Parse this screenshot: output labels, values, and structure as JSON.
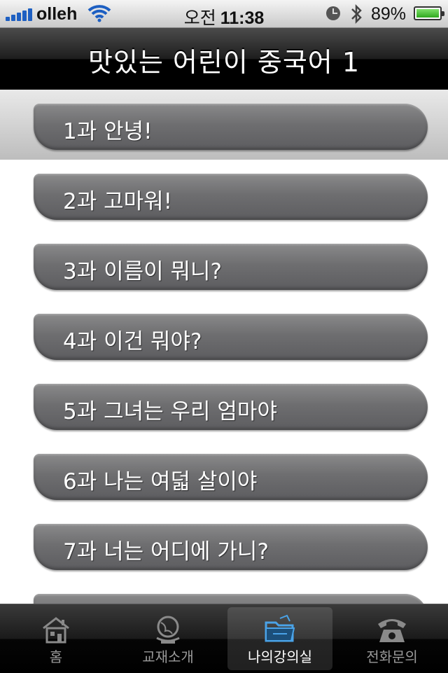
{
  "status_bar": {
    "carrier": "olleh",
    "time_period": "오전",
    "time": "11:38",
    "battery_percent": "89%"
  },
  "nav": {
    "title": "맛있는 어린이 중국어 1"
  },
  "lessons": [
    {
      "label": "1과 안녕!",
      "selected": true
    },
    {
      "label": "2과 고마워!",
      "selected": false
    },
    {
      "label": "3과 이름이 뭐니?",
      "selected": false
    },
    {
      "label": "4과 이건 뭐야?",
      "selected": false
    },
    {
      "label": "5과 그녀는 우리 엄마야",
      "selected": false
    },
    {
      "label": "6과 나는 여덟 살이야",
      "selected": false
    },
    {
      "label": "7과 너는 어디에 가니?",
      "selected": false
    },
    {
      "label": "",
      "selected": false
    }
  ],
  "tabs": [
    {
      "label": "홈",
      "icon": "house-icon",
      "active": false
    },
    {
      "label": "교재소개",
      "icon": "globe-icon",
      "active": false
    },
    {
      "label": "나의강의실",
      "icon": "folder-icon",
      "active": true
    },
    {
      "label": "전화문의",
      "icon": "telephone-icon",
      "active": false
    }
  ],
  "colors": {
    "lesson_button": "#6e6e70",
    "selected_row": "#d3d3d3",
    "tab_active_icon": "#4aa3e8"
  }
}
